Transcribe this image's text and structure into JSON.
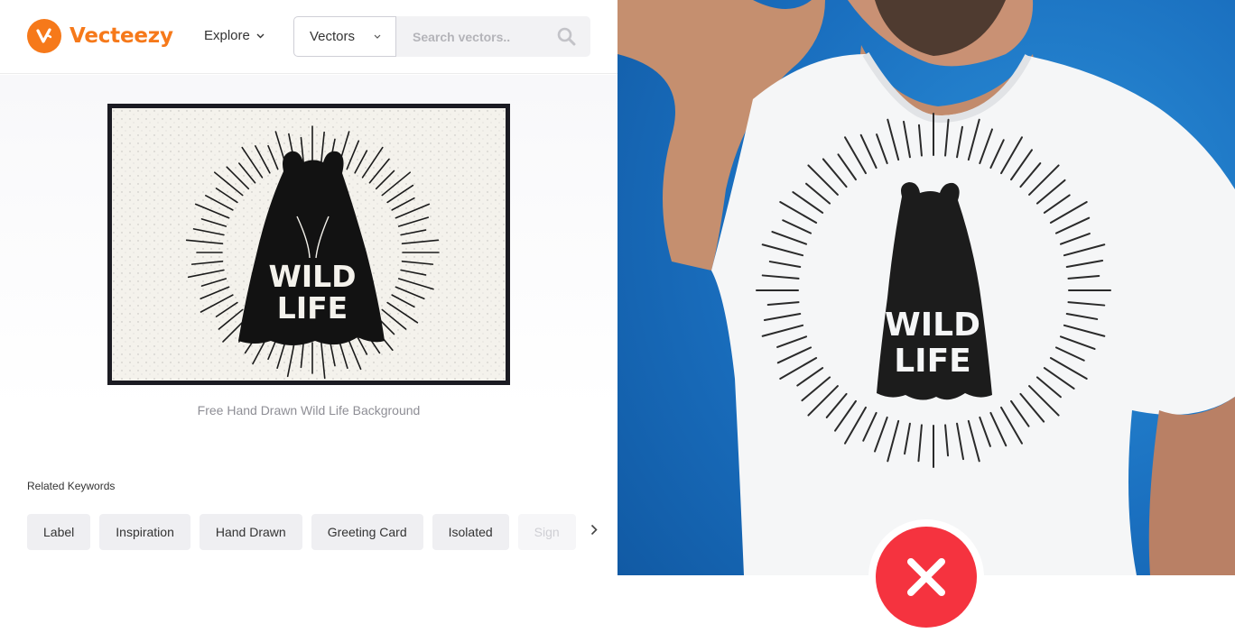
{
  "header": {
    "brand": "Vecteezy",
    "explore_label": "Explore",
    "search_type": "Vectors",
    "search_placeholder": "Search vectors.."
  },
  "preview": {
    "artwork_text_line1": "WILD",
    "artwork_text_line2": "LIFE",
    "caption": "Free Hand Drawn Wild Life Background"
  },
  "related": {
    "title": "Related Keywords",
    "tags": [
      "Label",
      "Inspiration",
      "Hand Drawn",
      "Greeting Card",
      "Isolated",
      "Sign"
    ]
  },
  "photo": {
    "shirt_text_line1": "WILD",
    "shirt_text_line2": "LIFE"
  },
  "colors": {
    "brand_orange": "#f6791a",
    "background_blue": "#1a6fbf",
    "reject_red": "#f5333f"
  },
  "icons": {
    "logo": "vecteezy-v-logo",
    "explore_dropdown": "chevron-down-icon",
    "search": "search-icon",
    "tags_next": "chevron-right-icon",
    "verdict": "close-icon"
  }
}
